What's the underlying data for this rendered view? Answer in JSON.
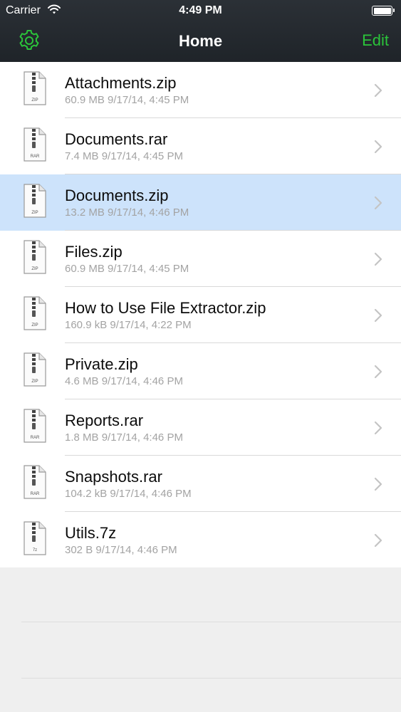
{
  "status_bar": {
    "carrier": "Carrier",
    "time": "4:49 PM"
  },
  "nav": {
    "title": "Home",
    "edit_label": "Edit",
    "accent_color": "#2bc43a"
  },
  "files": [
    {
      "name": "Attachments.zip",
      "size": "60.9 MB",
      "date": "9/17/14, 4:45 PM",
      "type": "ZIP",
      "selected": false
    },
    {
      "name": "Documents.rar",
      "size": "7.4 MB",
      "date": "9/17/14, 4:45 PM",
      "type": "RAR",
      "selected": false
    },
    {
      "name": "Documents.zip",
      "size": "13.2 MB",
      "date": "9/17/14, 4:46 PM",
      "type": "ZIP",
      "selected": true
    },
    {
      "name": "Files.zip",
      "size": "60.9 MB",
      "date": "9/17/14, 4:45 PM",
      "type": "ZIP",
      "selected": false
    },
    {
      "name": "How to Use File Extractor.zip",
      "size": "160.9 kB",
      "date": "9/17/14, 4:22 PM",
      "type": "ZIP",
      "selected": false
    },
    {
      "name": "Private.zip",
      "size": "4.6 MB",
      "date": "9/17/14, 4:46 PM",
      "type": "ZIP",
      "selected": false
    },
    {
      "name": "Reports.rar",
      "size": "1.8 MB",
      "date": "9/17/14, 4:46 PM",
      "type": "RAR",
      "selected": false
    },
    {
      "name": "Snapshots.rar",
      "size": "104.2 kB",
      "date": "9/17/14, 4:46 PM",
      "type": "RAR",
      "selected": false
    },
    {
      "name": "Utils.7z",
      "size": "302 B",
      "date": "9/17/14, 4:46 PM",
      "type": "7z",
      "selected": false
    }
  ]
}
